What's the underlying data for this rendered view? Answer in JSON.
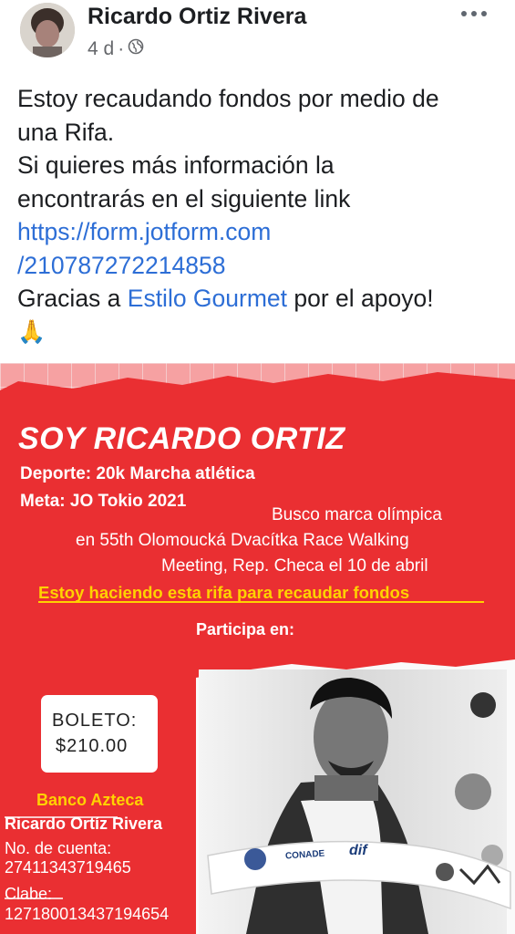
{
  "post": {
    "author": "Ricardo Ortiz Rivera",
    "time": "4 d",
    "separator": "·",
    "text_lines": [
      "Estoy recaudando fondos por medio de",
      "una Rifa.",
      "Si quieres más información la",
      "encontrarás en el siguiente link"
    ],
    "link_lines": [
      "https://form.jotform.com",
      "/210787272214858"
    ],
    "thanks_prefix": "Gracias a ",
    "thanks_page": "Estilo Gourmet",
    "thanks_suffix": " por el apoyo!",
    "emoji": "🙏"
  },
  "flyer": {
    "title": "SOY RICARDO ORTIZ",
    "deporte": "Deporte: 20k Marcha atlética",
    "meta": "Meta: JO Tokio 2021",
    "busco_lines": [
      "Busco marca olímpica",
      "en 55th Olomoucká Dvacítka Race Walking",
      "Meeting, Rep. Checa el 10 de abril"
    ],
    "rifa": "Estoy haciendo esta rifa para recaudar fondos",
    "participa": "Participa en:",
    "boleto_label": "BOLETO:",
    "boleto_price": "$210.00",
    "bank": "Banco Azteca",
    "account_name": "Ricardo Ortíz Rivera",
    "cuenta_label": "No. de cuenta:",
    "cuenta": "27411343719465",
    "clabe_label": "Clabe:",
    "clabe": "127180013437194654",
    "banner_logos": [
      "CONADE",
      "dif"
    ],
    "colors": {
      "red": "#ea2f32",
      "yellow": "#ffd200",
      "link": "#2d6ed6"
    }
  }
}
